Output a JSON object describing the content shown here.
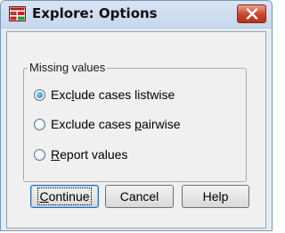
{
  "window": {
    "title": "Explore: Options"
  },
  "missing_values": {
    "legend": "Missing values",
    "options": [
      {
        "label_before": "Exc",
        "mnemonic": "l",
        "label_after": "ude cases listwise",
        "selected": true
      },
      {
        "label_before": "Exclude cases ",
        "mnemonic": "p",
        "label_after": "airwise",
        "selected": false
      },
      {
        "label_before": "",
        "mnemonic": "R",
        "label_after": "eport values",
        "selected": false
      }
    ]
  },
  "buttons": {
    "continue_mnemonic": "C",
    "continue_rest": "ontinue",
    "cancel": "Cancel",
    "help": "Help"
  },
  "colors": {
    "titlebar": "#c7d8ec",
    "close_button": "#c9442a",
    "dialog_bg": "#f0f0f0",
    "radio_selected": "#1b73c9"
  }
}
